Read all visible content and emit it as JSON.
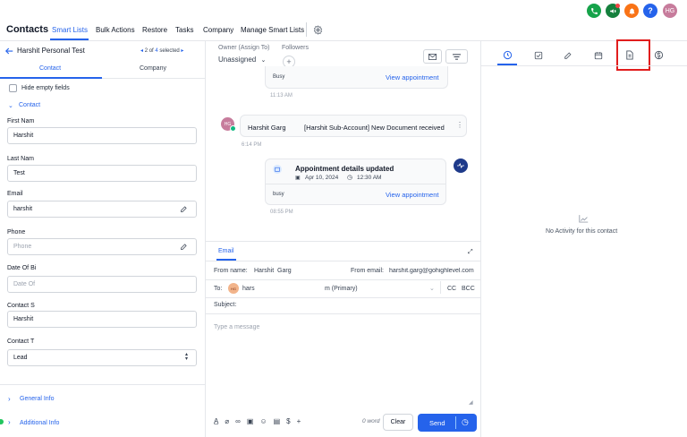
{
  "topnav": {
    "title": "Contacts",
    "tabs": [
      "Smart Lists",
      "Bulk Actions",
      "Restore",
      "Tasks",
      "Company",
      "Manage Smart Lists"
    ],
    "avatar_initials": "HG",
    "colors": {
      "active": "#2563eb",
      "phone": "#16a34a",
      "megaphone": "#15803d",
      "bell": "#f97316",
      "help": "#2563eb",
      "avatar": "#c77c9c"
    }
  },
  "left": {
    "back_title": "Harshit Personal Test",
    "pager": {
      "current": "2 of",
      "count": "4",
      "selected": "selected"
    },
    "tabs": [
      "Contact",
      "Company"
    ],
    "hide_empty": "Hide empty fields",
    "section_contact": "Contact",
    "fields": [
      {
        "label": "First Nam",
        "value": "Harshit"
      },
      {
        "label": "Last Nam",
        "value": "Test"
      },
      {
        "label": "Email",
        "value": "harshit"
      },
      {
        "label": "Phone",
        "value": "",
        "placeholder": "Phone"
      },
      {
        "label": "Date Of Bi",
        "value": "",
        "placeholder": "Date Of"
      },
      {
        "label": "Contact S",
        "value": "Harshit"
      },
      {
        "label": "Contact T",
        "value": "Lead"
      }
    ],
    "general_info": "General Info",
    "additional_info": "Additional Info"
  },
  "middle": {
    "owner_label": "Owner (Assign To)",
    "owner_value": "Unassigned",
    "followers_label": "Followers",
    "activity1": {
      "status": "Busy",
      "link": "View appointment",
      "time": "11:13 AM"
    },
    "activity2": {
      "avatar": "HG",
      "name": "Harshit Garg",
      "subject": "[Harshit Sub-Account] New Document received",
      "time": "6:14 PM"
    },
    "activity3": {
      "title": "Appointment details updated",
      "date": "Apr 10, 2024",
      "clock": "12:30 AM",
      "status": "busy",
      "link": "View appointment",
      "time": "08:55 PM"
    },
    "composer": {
      "tab": "Email",
      "from_name_label": "From name:",
      "from_name": "Harshit  Garg",
      "from_email_label": "From email:",
      "from_email": "harshit.garg@gohighlevel.com",
      "to_label": "To:",
      "to_avatar": "HG",
      "to_name": "hars",
      "to_primary": "m (Primary)",
      "cc": "CC",
      "bcc": "BCC",
      "subject_label": "Subject:",
      "body_placeholder": "Type a message",
      "word_count": "0 word",
      "clear": "Clear",
      "send": "Send"
    }
  },
  "right": {
    "empty_text": "No Activity for this contact",
    "highlight_color": "#e11d1d"
  }
}
